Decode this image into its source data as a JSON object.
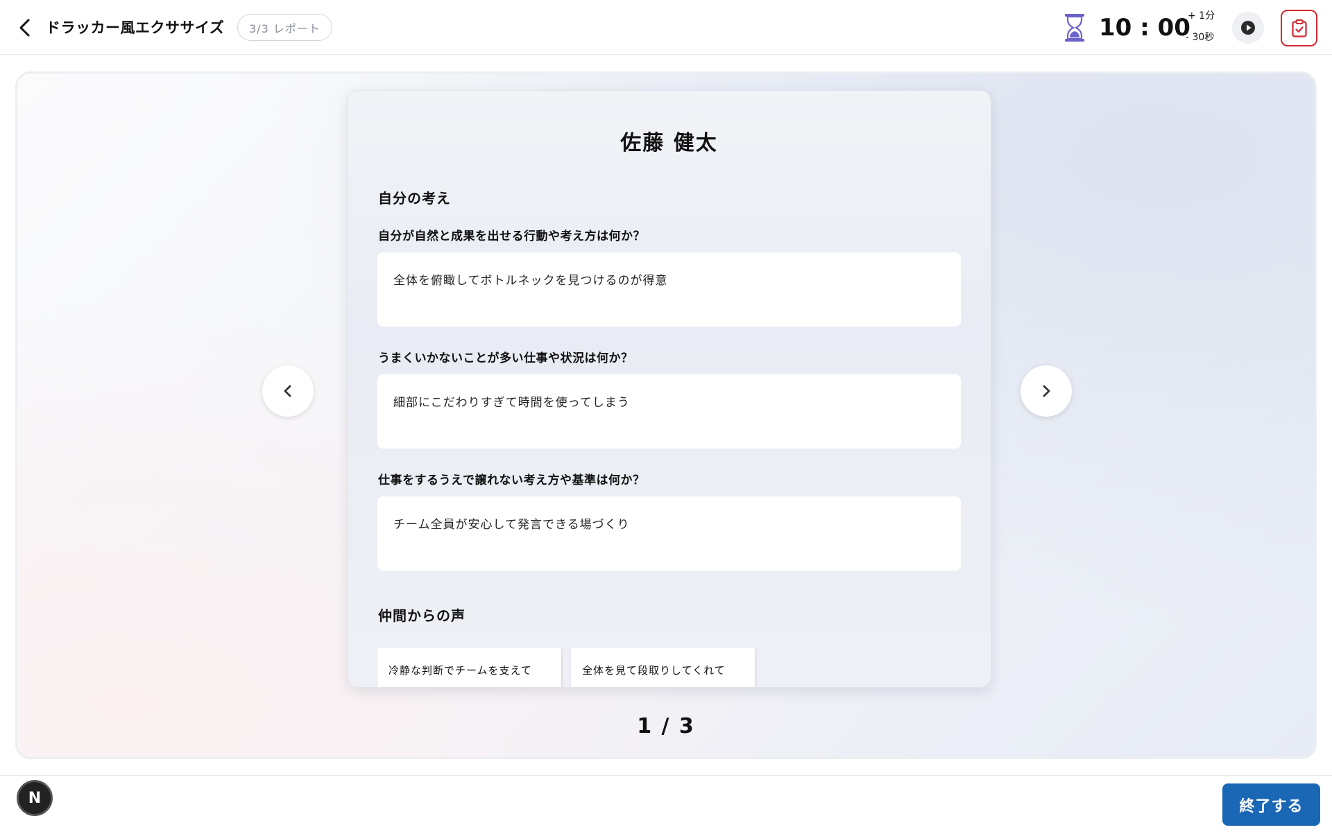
{
  "header": {
    "title": "ドラッカー風エクササイズ",
    "progress_badge": "3/3  レポート",
    "timer": "10 : 00",
    "add_time_label": "+ 1分",
    "subtract_time_label": "- 30秒"
  },
  "card": {
    "name": "佐藤 健太",
    "self_section_heading": "自分の考え",
    "questions": [
      {
        "question": "自分が自然と成果を出せる行動や考え方は何か？",
        "answer": "全体を俯瞰してボトルネックを見つけるのが得意"
      },
      {
        "question": "うまくいかないことが多い仕事や状況は何か？",
        "answer": "細部にこだわりすぎて時間を使ってしまう"
      },
      {
        "question": "仕事をするうえで譲れない考え方や基準は何か？",
        "answer": "チーム全員が安心して発言できる場づくり"
      }
    ],
    "peer_section_heading": "仲間からの声",
    "peer_voices": [
      "冷静な判断でチームを支えて",
      "全体を見て段取りしてくれて"
    ]
  },
  "pagination": {
    "indicator": "1 / 3"
  },
  "footer": {
    "dev_badge": "N",
    "finish_button": "終了する"
  },
  "colors": {
    "accent_blue": "#1a67b5",
    "alert_red": "#d2262f",
    "hourglass_purple": "#6b63c9"
  },
  "icons": {
    "back": "chevron-left-icon",
    "timer": "hourglass-icon",
    "play": "play-icon",
    "report": "clipboard-check-icon",
    "prev": "chevron-left-icon",
    "next": "chevron-right-icon"
  }
}
